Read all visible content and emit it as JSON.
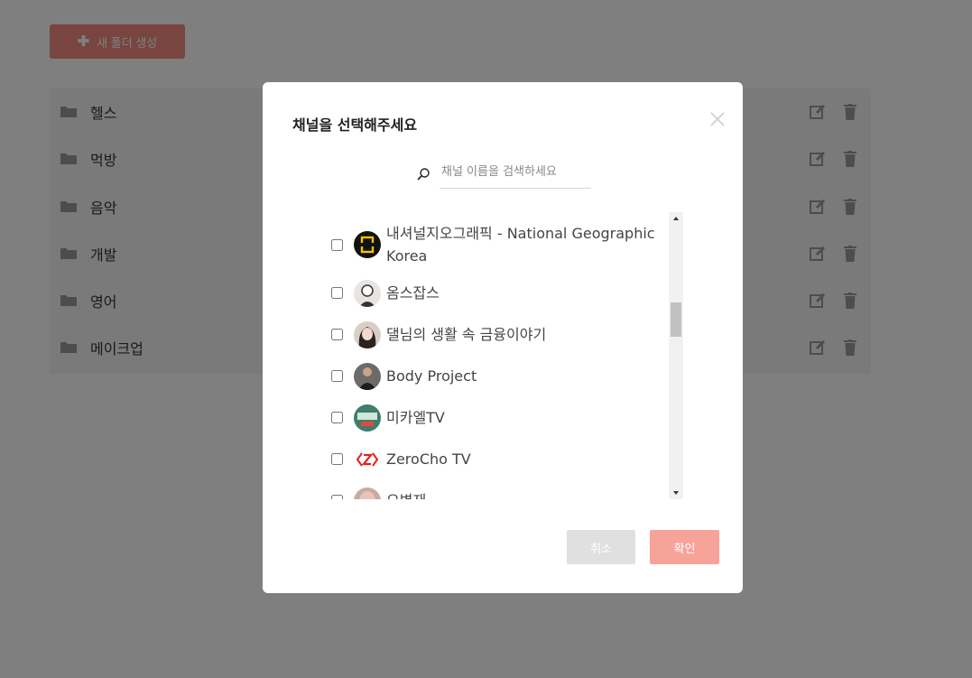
{
  "toolbar": {
    "new_folder_label": "새 폴더 생성"
  },
  "folders": [
    {
      "name": "헬스"
    },
    {
      "name": "먹방"
    },
    {
      "name": "음악"
    },
    {
      "name": "개발"
    },
    {
      "name": "영어"
    },
    {
      "name": "메이크업"
    }
  ],
  "modal": {
    "title": "채널을 선택해주세요",
    "search_placeholder": "채널 이름을 검색하세요",
    "search_value": "",
    "channels": [
      {
        "name": "내셔널지오그래픽 - National Geographic Korea",
        "checked": false,
        "avatar": "national-geographic-logo"
      },
      {
        "name": "옴스잡스",
        "checked": false,
        "avatar": "person-avatar"
      },
      {
        "name": "댈님의 생활 속 금융이야기",
        "checked": false,
        "avatar": "person-avatar"
      },
      {
        "name": "Body Project",
        "checked": false,
        "avatar": "person-avatar"
      },
      {
        "name": "미카엘TV",
        "checked": false,
        "avatar": "channel-logo"
      },
      {
        "name": "ZeroCho TV",
        "checked": false,
        "avatar": "zerocho-logo"
      },
      {
        "name": "오병재",
        "checked": false,
        "avatar": "person-avatar"
      }
    ],
    "cancel_label": "취소",
    "confirm_label": "확인"
  },
  "colors": {
    "accent": "#f08b80",
    "confirm": "#f8a39a",
    "cancel": "#e0e0e0",
    "overlay": "rgba(0,0,0,0.5)"
  }
}
